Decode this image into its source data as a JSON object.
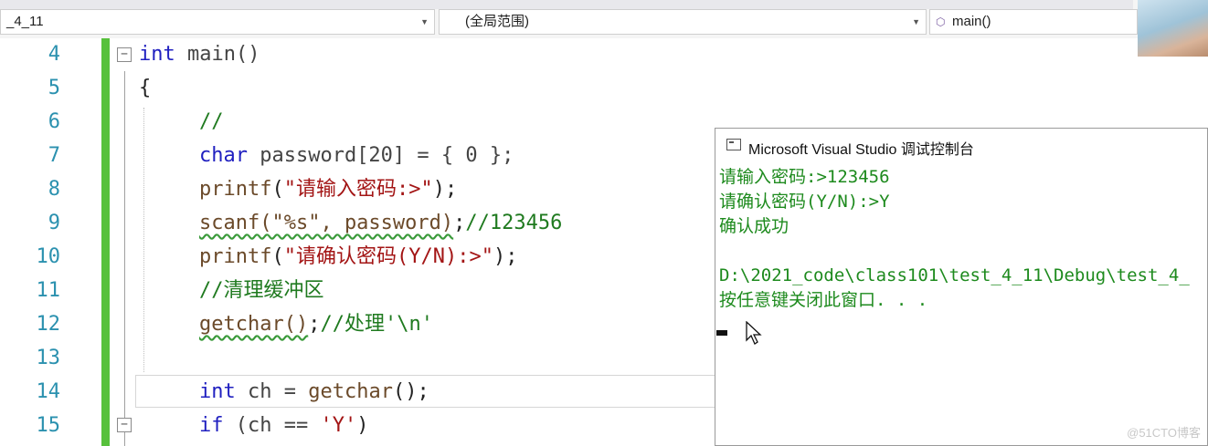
{
  "navbar": {
    "project_dropdown": "_4_11",
    "scope_dropdown": "(全局范围)",
    "function_dropdown": "main()"
  },
  "editor": {
    "line_numbers": [
      "4",
      "5",
      "6",
      "7",
      "8",
      "9",
      "10",
      "11",
      "12",
      "13",
      "14",
      "15"
    ],
    "lines": {
      "l4_kw": "int",
      "l4_rest": " main()",
      "l5": "{",
      "l6": "//",
      "l7_kw": "char",
      "l7_rest": " password[20] = { 0 };",
      "l8_fn": "printf",
      "l8_open": "(",
      "l8_str": "\"请输入密码:>\"",
      "l8_close": ");",
      "l9_squig": "scanf(\"%s\", password)",
      "l9_semi": ";",
      "l9_cm": "//123456",
      "l10_fn": "printf",
      "l10_open": "(",
      "l10_str": "\"请确认密码(Y/N):>\"",
      "l10_close": ");",
      "l11_cm": "//清理缓冲区",
      "l12_squig": "getchar()",
      "l12_semi": ";",
      "l12_cm": "//处理'\\n'",
      "l14_kw": "int",
      "l14_rest": " ch = ",
      "l14_fn": "getchar",
      "l14_end": "();",
      "l15_kw": "if",
      "l15_open": " (ch == ",
      "l15_str": "'Y'",
      "l15_close": ")"
    }
  },
  "console": {
    "title": "Microsoft Visual Studio 调试控制台",
    "output": [
      "请输入密码:>123456",
      "请确认密码(Y/N):>Y",
      "确认成功",
      "",
      "D:\\2021_code\\class101\\test_4_11\\Debug\\test_4_",
      "按任意键关闭此窗口. . ."
    ]
  },
  "watermark": "@51CTO博客",
  "colors": {
    "keyword": "#2020c0",
    "string": "#a31515",
    "comment": "#1f7a1f",
    "line_number": "#2b91af",
    "console_text": "#1d8a1d",
    "change_bar": "#57c13c"
  }
}
